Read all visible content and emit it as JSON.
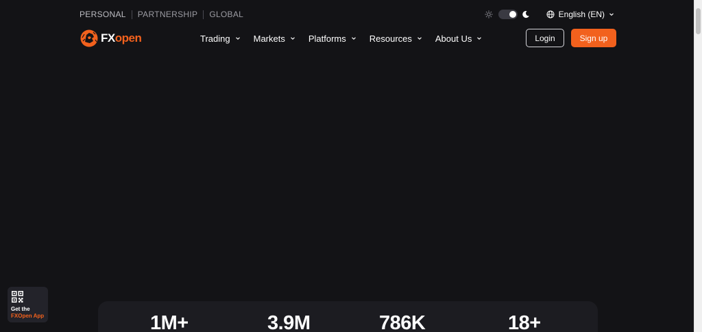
{
  "colors": {
    "background": "#131316",
    "accent": "#f2611d",
    "muted_text": "#9c9ca3",
    "stats_panel": "#1c1c21"
  },
  "top_bar": {
    "links": [
      "PERSONAL",
      "PARTNERSHIP",
      "GLOBAL"
    ],
    "language": "English (EN)",
    "theme_toggle": {
      "mode": "dark",
      "icons": [
        "sun-icon",
        "moon-icon"
      ]
    }
  },
  "logo": {
    "fx": "FX",
    "open": "open"
  },
  "nav": {
    "items": [
      "Trading",
      "Markets",
      "Platforms",
      "Resources",
      "About Us"
    ]
  },
  "auth": {
    "login_label": "Login",
    "signup_label": "Sign up"
  },
  "app_badge": {
    "line1": "Get the",
    "line2": "FXOpen App",
    "icon": "qr-code-icon"
  },
  "stats": [
    "1M+",
    "3.9M",
    "786K",
    "18+"
  ]
}
